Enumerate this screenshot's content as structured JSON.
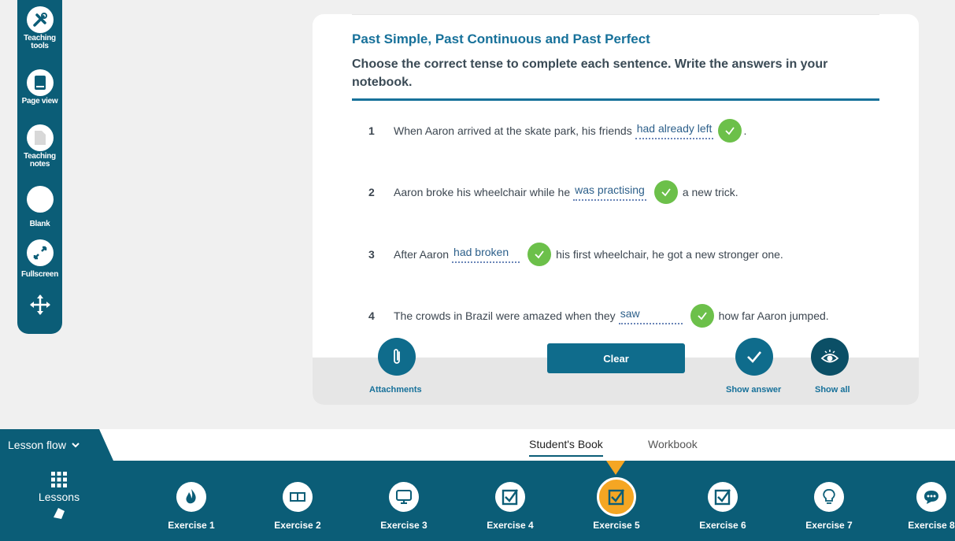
{
  "toolbar": {
    "teaching_tools": "Teaching tools",
    "page_view": "Page view",
    "teaching_notes": "Teaching notes",
    "blank": "Blank",
    "fullscreen": "Fullscreen"
  },
  "exercise": {
    "title": "Past Simple, Past Continuous and Past Perfect",
    "instruction": "Choose the correct tense to complete each sentence. Write the answers in your notebook.",
    "questions": [
      {
        "num": "1",
        "before": "When Aaron arrived at the skate park, his friends",
        "answer": "had already left",
        "after": "."
      },
      {
        "num": "2",
        "before": "Aaron broke his wheelchair while he",
        "answer": "was practising",
        "after": "a new trick."
      },
      {
        "num": "3",
        "before": "After Aaron",
        "answer": "had broken",
        "after": "his first wheelchair, he got a new stronger one."
      },
      {
        "num": "4",
        "before": "The crowds in Brazil were amazed when they",
        "answer": "saw",
        "after": "how far Aaron jumped."
      }
    ],
    "attachments_label": "Attachments",
    "clear_label": "Clear",
    "show_answer_label": "Show answer",
    "show_all_label": "Show all"
  },
  "lesson_flow": {
    "label": "Lesson flow"
  },
  "tabs": {
    "students_book": "Student's Book",
    "workbook": "Workbook"
  },
  "lessons_label": "Lessons",
  "exercises": [
    {
      "label": "Exercise 1",
      "icon": "flame-icon"
    },
    {
      "label": "Exercise 2",
      "icon": "book-icon"
    },
    {
      "label": "Exercise 3",
      "icon": "monitor-icon"
    },
    {
      "label": "Exercise 4",
      "icon": "checkbox-icon"
    },
    {
      "label": "Exercise 5",
      "icon": "checkbox-icon",
      "active": true
    },
    {
      "label": "Exercise 6",
      "icon": "checkbox-icon"
    },
    {
      "label": "Exercise 7",
      "icon": "lightbulb-icon"
    },
    {
      "label": "Exercise 8",
      "icon": "chat-icon"
    }
  ],
  "colors": {
    "brand": "#0b5d77",
    "accent": "#f5a623",
    "correct": "#6cc04a",
    "title": "#17719a"
  }
}
